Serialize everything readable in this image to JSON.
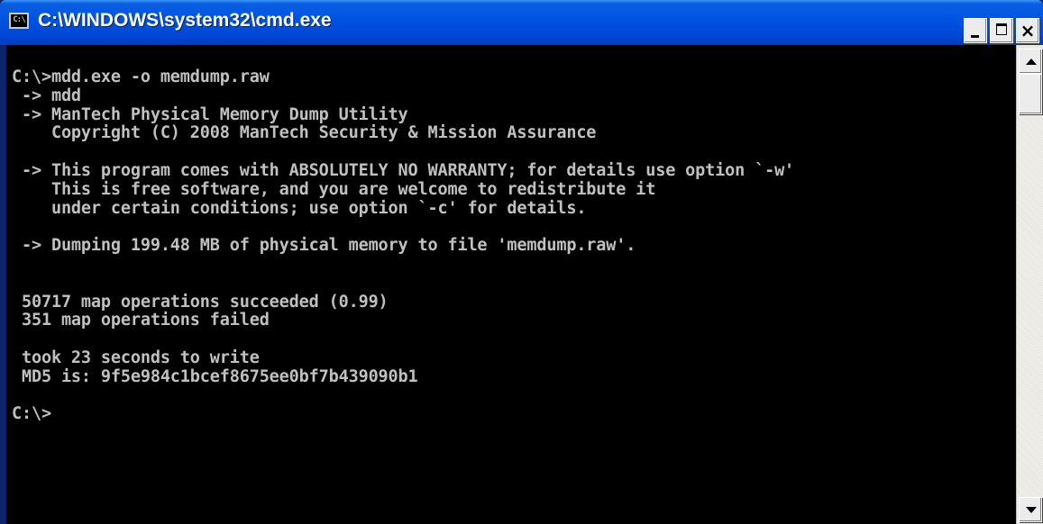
{
  "window": {
    "title": "C:\\WINDOWS\\system32\\cmd.exe",
    "icon_text": "C:\\",
    "buttons": {
      "minimize": "minimize-icon",
      "maximize": "maximize-icon",
      "close": "×"
    }
  },
  "console": {
    "text_color": "#c0c0c0",
    "background": "#000000",
    "lines": [
      "C:\\>mdd.exe -o memdump.raw",
      " -> mdd",
      " -> ManTech Physical Memory Dump Utility",
      "    Copyright (C) 2008 ManTech Security & Mission Assurance",
      "",
      " -> This program comes with ABSOLUTELY NO WARRANTY; for details use option `-w'",
      "    This is free software, and you are welcome to redistribute it",
      "    under certain conditions; use option `-c' for details.",
      "",
      " -> Dumping 199.48 MB of physical memory to file 'memdump.raw'.",
      "",
      "",
      " 50717 map operations succeeded (0.99)",
      " 351 map operations failed",
      "",
      " took 23 seconds to write",
      " MD5 is: 9f5e984c1bcef8675ee0bf7b439090b1",
      "",
      "C:\\>"
    ]
  },
  "scrollbar": {
    "up": "scroll-up-arrow-icon",
    "down": "scroll-down-arrow-icon"
  }
}
